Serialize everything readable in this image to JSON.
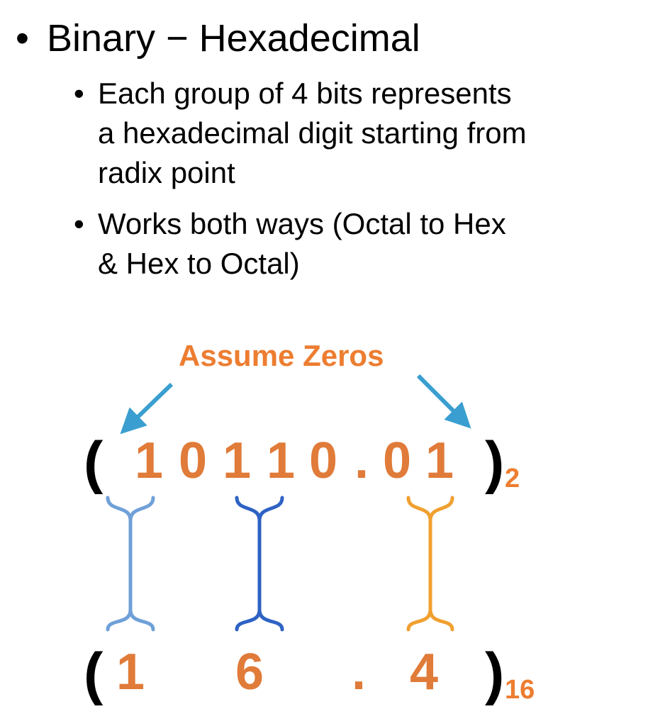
{
  "bullets": {
    "main": "Binary − Hexadecimal",
    "sub1_line1": "Each group of 4 bits represents",
    "sub1_line2": "a hexadecimal digit starting from",
    "sub1_line3": "radix point",
    "sub2_line1": "Works both ways (Octal to Hex",
    "sub2_line2": "& Hex to Octal)",
    "dot": "•"
  },
  "diagram": {
    "annotation": "Assume Zeros",
    "binary": {
      "open": "(",
      "digits": [
        "1",
        "0",
        "1",
        "1",
        "0",
        ".",
        "0",
        "1"
      ],
      "close": ")",
      "base": "2"
    },
    "hex": {
      "open": "(",
      "digits": [
        "1",
        "6",
        ".",
        "4"
      ],
      "close": ")",
      "base": "16"
    },
    "colors": {
      "digit": "#E07B39",
      "annotation": "#ED7D31",
      "arrow": "#3A9FD0",
      "brace1": "#6FA0D8",
      "brace2": "#2E62C4",
      "brace3": "#F0A030"
    }
  }
}
